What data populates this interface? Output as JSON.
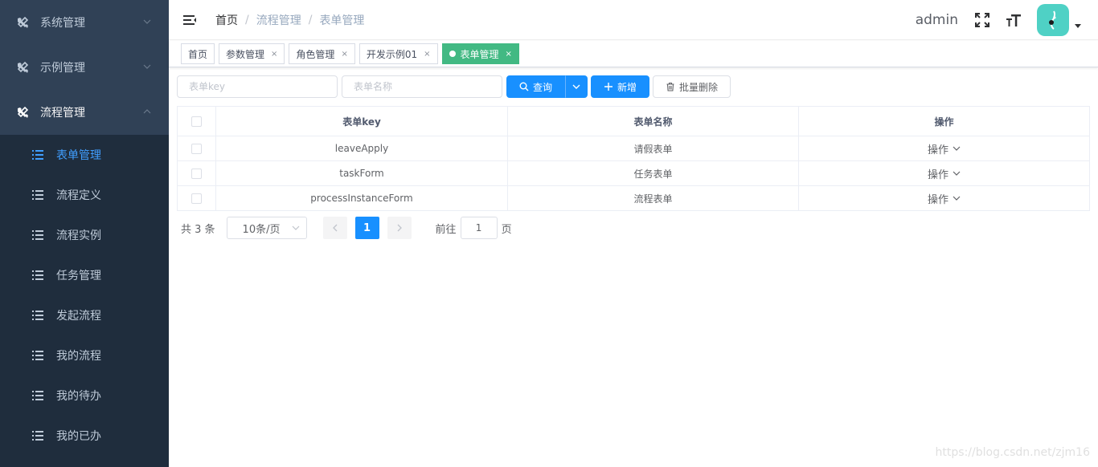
{
  "sidebar": {
    "groups": [
      {
        "label": "系统管理",
        "expanded": false
      },
      {
        "label": "示例管理",
        "expanded": false
      },
      {
        "label": "流程管理",
        "expanded": true
      }
    ],
    "items": [
      {
        "label": "表单管理",
        "active": true
      },
      {
        "label": "流程定义"
      },
      {
        "label": "流程实例"
      },
      {
        "label": "任务管理"
      },
      {
        "label": "发起流程"
      },
      {
        "label": "我的流程"
      },
      {
        "label": "我的待办"
      },
      {
        "label": "我的已办"
      }
    ]
  },
  "header": {
    "breadcrumb": [
      "首页",
      "流程管理",
      "表单管理"
    ],
    "separator": "/",
    "username": "admin"
  },
  "tags": [
    {
      "label": "首页",
      "closable": false
    },
    {
      "label": "参数管理",
      "closable": true
    },
    {
      "label": "角色管理",
      "closable": true
    },
    {
      "label": "开发示例01",
      "closable": true
    },
    {
      "label": "表单管理",
      "closable": true,
      "active": true
    }
  ],
  "close_glyph": "×",
  "search": {
    "key_placeholder": "表单key",
    "name_placeholder": "表单名称",
    "query_label": "查询",
    "add_label": "新增",
    "batch_delete_label": "批量删除"
  },
  "table": {
    "headers": [
      "表单key",
      "表单名称",
      "操作"
    ],
    "rows": [
      {
        "key": "leaveApply",
        "name": "请假表单",
        "op": "操作"
      },
      {
        "key": "taskForm",
        "name": "任务表单",
        "op": "操作"
      },
      {
        "key": "processInstanceForm",
        "name": "流程表单",
        "op": "操作"
      }
    ]
  },
  "pagination": {
    "total_text": "共 3 条",
    "page_size": "10条/页",
    "current_page": "1",
    "goto_prefix": "前往",
    "goto_value": "1",
    "goto_suffix": "页"
  },
  "watermark": "https://blog.csdn.net/zjm16",
  "colors": {
    "sidebar_bg": "#1f2d3d",
    "sidebar_group_bg": "#304156",
    "active_menu": "#409eff",
    "primary": "#1890ff",
    "active_tag": "#42b983",
    "avatar_bg": "#4fd1c5"
  }
}
